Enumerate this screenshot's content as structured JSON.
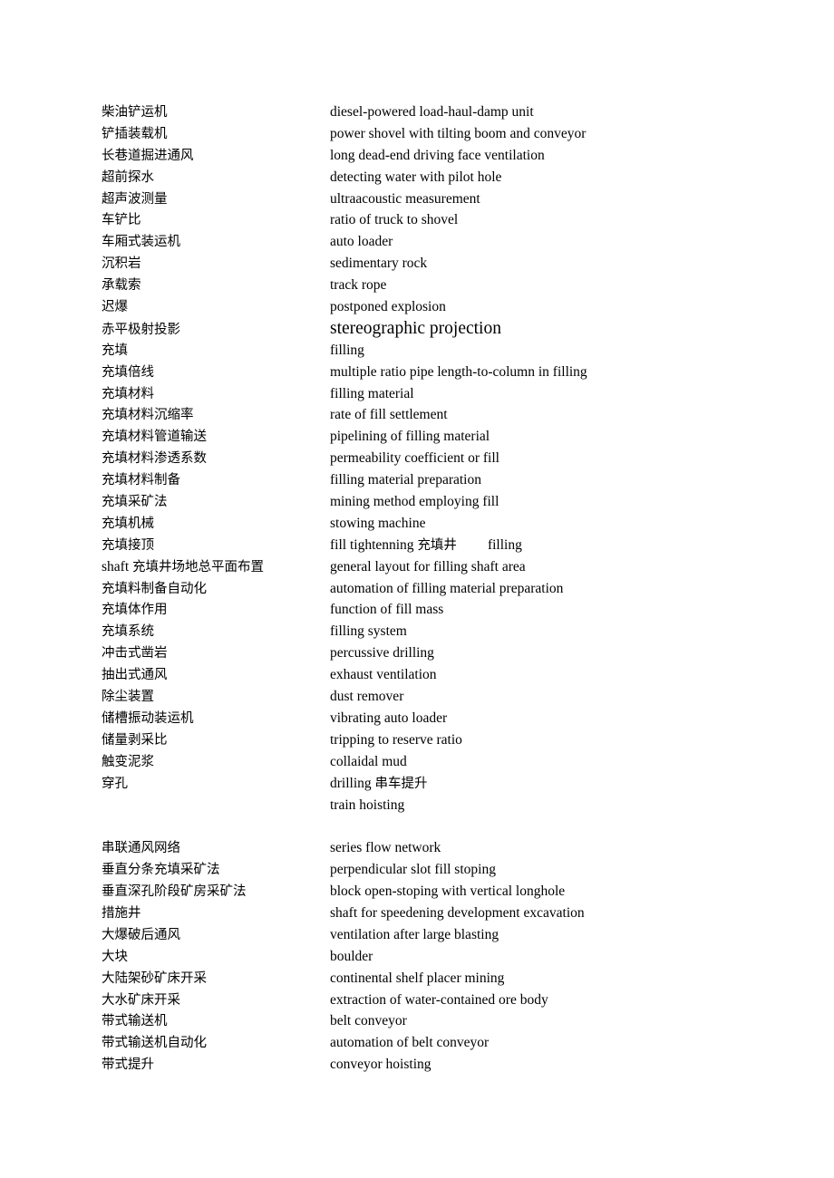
{
  "document": {
    "kind": "bilingual-glossary",
    "language_pair": "Chinese-English",
    "subject": "mining engineering terminology",
    "page_background": "#ffffff",
    "text_color": "#000000"
  },
  "entries": [
    {
      "term": "柴油铲运机",
      "gloss": "diesel-powered load-haul-damp unit"
    },
    {
      "term": "铲插装载机",
      "gloss": "power shovel with tilting boom and conveyor"
    },
    {
      "term": "长巷道掘进通风",
      "gloss": "long dead-end driving face ventilation"
    },
    {
      "term": "超前探水",
      "gloss": "detecting water with pilot hole"
    },
    {
      "term": "超声波测量",
      "gloss": "ultraacoustic measurement"
    },
    {
      "term": "车铲比",
      "gloss": "ratio of truck to shovel"
    },
    {
      "term": "车厢式装运机",
      "gloss": "auto loader"
    },
    {
      "term": "沉积岩",
      "gloss": "sedimentary rock"
    },
    {
      "term": "承载索",
      "gloss": "track rope"
    },
    {
      "term": "迟爆",
      "gloss": "postponed explosion"
    },
    {
      "term": "赤平极射投影",
      "gloss": "stereographic projection",
      "emphasis": true
    },
    {
      "term": "充填",
      "gloss": "filling"
    },
    {
      "term": "充填倍线",
      "gloss": "multiple ratio pipe length-to-column in filling"
    },
    {
      "term": "充填材料",
      "gloss": "filling material"
    },
    {
      "term": "充填材料沉缩率",
      "gloss": "rate of fill settlement"
    },
    {
      "term": "充填材料管道输送",
      "gloss": "pipelining of filling material"
    },
    {
      "term": "充填材料渗透系数",
      "gloss": "permeability coefficient or fill"
    },
    {
      "term": "充填材料制备",
      "gloss": "filling material preparation"
    },
    {
      "term": "充填采矿法",
      "gloss": "mining method employing fill"
    },
    {
      "term": "充填机械",
      "gloss": "stowing machine"
    },
    {
      "term": "充填接顶",
      "gloss": "fill tightenning 充填井    filling",
      "gloss_parts": [
        {
          "text": "fill tightenning ",
          "script": "latin"
        },
        {
          "text": "充填井",
          "script": "cjk"
        },
        {
          "text": "",
          "script": "gap"
        },
        {
          "text": "filling",
          "script": "latin"
        }
      ]
    },
    {
      "term": "shaft 充填井场地总平面布置",
      "term_parts": [
        {
          "text": "shaft ",
          "script": "latin"
        },
        {
          "text": "充填井场地总平面布置",
          "script": "cjk"
        }
      ],
      "gloss": "general layout for filling shaft area"
    },
    {
      "term": "充填料制备自动化",
      "gloss": "automation of filling material preparation"
    },
    {
      "term": "充填体作用",
      "gloss": "function of fill mass"
    },
    {
      "term": "充填系统",
      "gloss": "filling system"
    },
    {
      "term": "冲击式凿岩",
      "gloss": "percussive drilling"
    },
    {
      "term": "抽出式通风",
      "gloss": "exhaust ventilation"
    },
    {
      "term": "除尘装置",
      "gloss": "dust remover"
    },
    {
      "term": "储槽振动装运机",
      "gloss": "vibrating auto loader"
    },
    {
      "term": "储量剥采比",
      "gloss": "tripping to reserve ratio"
    },
    {
      "term": "触变泥浆",
      "gloss": "collaidal mud"
    },
    {
      "term": "穿孔",
      "gloss": "drilling 串车提升",
      "gloss_parts": [
        {
          "text": "drilling ",
          "script": "latin"
        },
        {
          "text": "串车提升",
          "script": "cjk"
        }
      ]
    },
    {
      "term": "",
      "gloss": "train hoisting",
      "blank_after": true
    },
    {
      "term": "串联通风网络",
      "gloss": "series flow network"
    },
    {
      "term": "垂直分条充填采矿法",
      "gloss": "perpendicular slot fill stoping"
    },
    {
      "term": "垂直深孔阶段矿房采矿法",
      "gloss": "block open-stoping with vertical longhole"
    },
    {
      "term": "措施井",
      "gloss": "shaft for speedening development excavation"
    },
    {
      "term": "大爆破后通风",
      "gloss": "ventilation after large blasting"
    },
    {
      "term": "大块",
      "gloss": "boulder"
    },
    {
      "term": "大陆架砂矿床开采",
      "gloss": "continental shelf placer mining"
    },
    {
      "term": "大水矿床开采",
      "gloss": "extraction of water-contained ore body"
    },
    {
      "term": "带式输送机",
      "gloss": "belt conveyor"
    },
    {
      "term": "带式输送机自动化",
      "gloss": "automation of belt conveyor"
    },
    {
      "term": "带式提升",
      "gloss": "conveyor hoisting"
    }
  ]
}
